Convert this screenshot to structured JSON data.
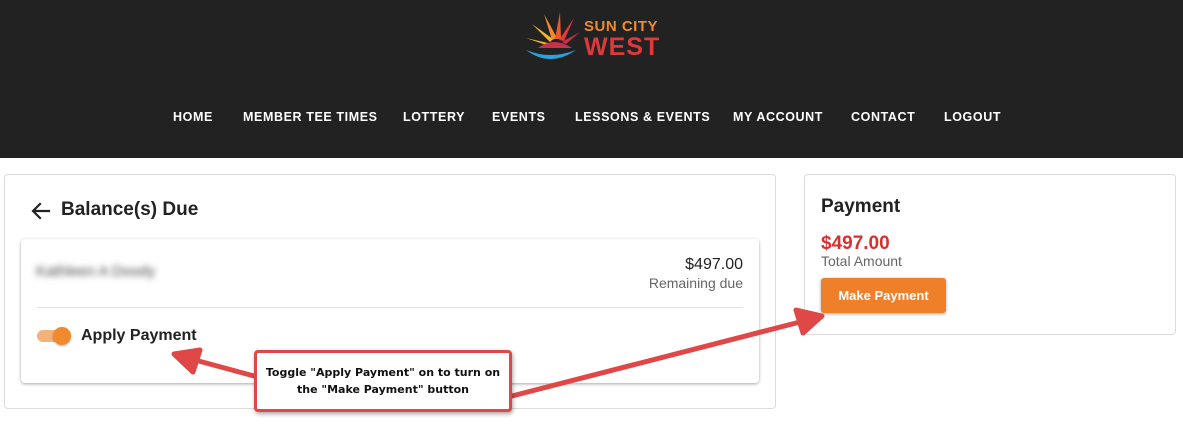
{
  "header": {
    "logo": {
      "line1": "SUN CITY",
      "line2": "WEST",
      "colors": {
        "orange": "#f08a2c",
        "red": "#e0383b",
        "blue": "#2aa3dc"
      }
    },
    "background": "#222222"
  },
  "nav": {
    "items": [
      {
        "label": "HOME"
      },
      {
        "label": "MEMBER TEE TIMES"
      },
      {
        "label": "LOTTERY"
      },
      {
        "label": "EVENTS"
      },
      {
        "label": "LESSONS & EVENTS"
      },
      {
        "label": "MY ACCOUNT"
      },
      {
        "label": "CONTACT"
      },
      {
        "label": "LOGOUT"
      }
    ]
  },
  "balance": {
    "back_icon": "arrow-left-icon",
    "title": "Balance(s) Due",
    "member_name": "Kathleen A Doody",
    "amount": "$497.00",
    "remaining_label": "Remaining due",
    "apply_payment": {
      "label": "Apply Payment",
      "on": true
    }
  },
  "payment": {
    "title": "Payment",
    "amount": "$497.00",
    "total_label": "Total Amount",
    "button_label": "Make Payment"
  },
  "annotation": {
    "text": "Toggle \"Apply Payment\" on to turn on the \"Make Payment\" button",
    "color": "#e04848"
  },
  "colors": {
    "accent": "#f07f2a",
    "amount_red": "#d92f2f"
  }
}
